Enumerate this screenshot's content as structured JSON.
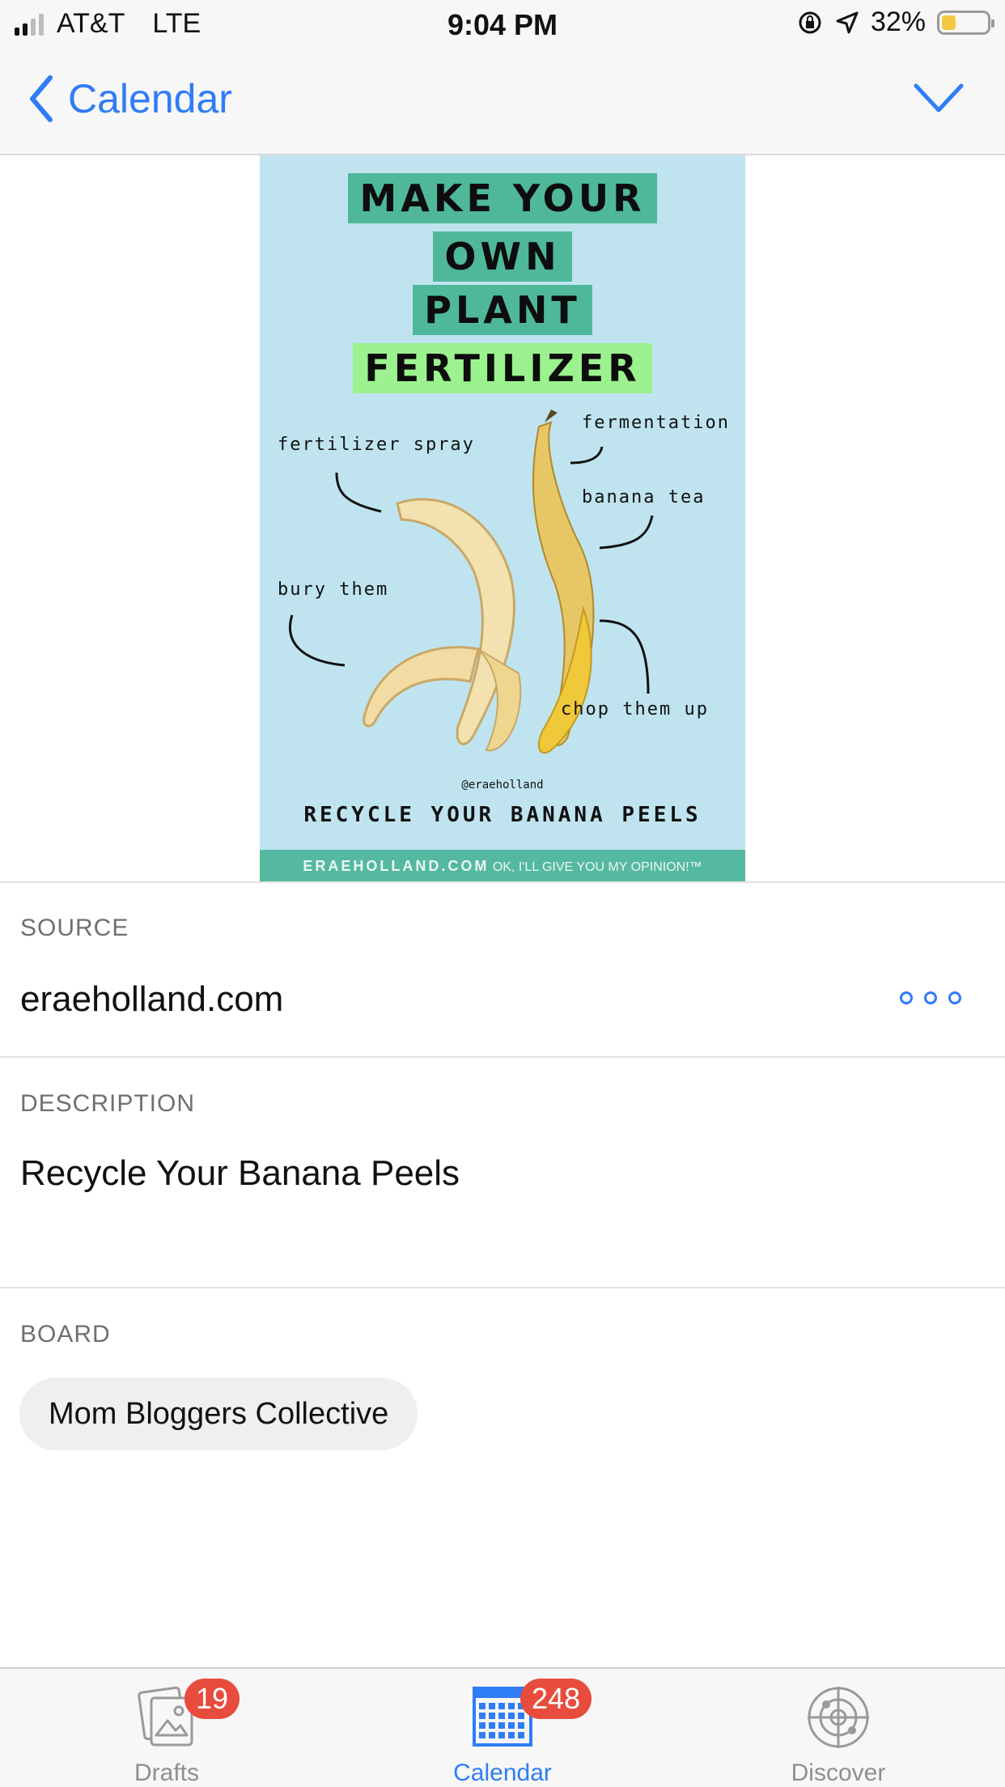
{
  "status_bar": {
    "carrier": "AT&T",
    "network": "LTE",
    "time": "9:04 PM",
    "battery_percent": "32%",
    "battery_level": 0.32,
    "icons": [
      "signal-icon",
      "orientation-lock-icon",
      "location-arrow-icon",
      "battery-icon"
    ]
  },
  "nav": {
    "back_label": "Calendar",
    "confirm_icon": "checkmark-icon",
    "accent_color": "#2f7df6"
  },
  "pin": {
    "title_lines": [
      "MAKE YOUR",
      "OWN",
      "PLANT",
      "FERTILIZER"
    ],
    "annotations": {
      "fertilizer_spray": "fertilizer spray",
      "fermentation": "fermentation",
      "banana_tea": "banana tea",
      "bury_them": "bury them",
      "chop_them_up": "chop them up"
    },
    "handle": "@eraeholland",
    "recycle": "RECYCLE YOUR BANANA PEELS",
    "footer_site": "ERAEHOLLAND.COM",
    "footer_tagline": "OK, I'LL GIVE YOU MY OPINION!™"
  },
  "details": {
    "source_label": "SOURCE",
    "source_value": "eraeholland.com",
    "description_label": "DESCRIPTION",
    "description_value": "Recycle Your Banana Peels",
    "board_label": "BOARD",
    "board_value": "Mom Bloggers Collective"
  },
  "tabs": [
    {
      "label": "Drafts",
      "badge": "19",
      "icon": "drafts-icon"
    },
    {
      "label": "Calendar",
      "badge": "248",
      "icon": "calendar-icon"
    },
    {
      "label": "Discover",
      "badge": "",
      "icon": "discover-icon"
    }
  ]
}
